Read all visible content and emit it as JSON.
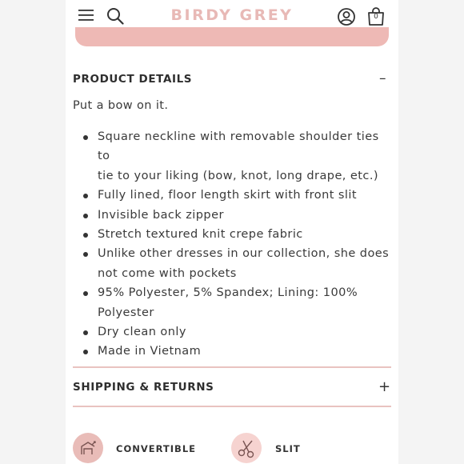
{
  "header": {
    "brand": "BIRDY GREY",
    "cart_count": "0"
  },
  "product_details": {
    "title": "PRODUCT DETAILS",
    "toggle": "–",
    "intro": "Put a bow on it.",
    "bullets": [
      [
        "Square neckline with removable shoulder ties to",
        "tie to your liking (bow, knot, long drape, etc.)"
      ],
      [
        "Fully lined, floor length skirt with front slit"
      ],
      [
        "Invisible back zipper"
      ],
      [
        "Stretch textured knit crepe fabric"
      ],
      [
        "Unlike other dresses in our collection, she does",
        "not come with pockets"
      ],
      [
        "95% Polyester, 5% Spandex; Lining: 100%",
        "Polyester"
      ],
      [
        "Dry clean only"
      ],
      [
        "Made in Vietnam"
      ]
    ]
  },
  "shipping": {
    "title": "SHIPPING & RETURNS",
    "toggle": "+"
  },
  "features": [
    {
      "label": "CONVERTIBLE",
      "icon": "convertible-icon"
    },
    {
      "label": "SLIT",
      "icon": "scissors-icon"
    }
  ],
  "colors": {
    "brand": "#e8b9b6",
    "divider": "#e9c3c0",
    "accent_bar": "#eeb9b5"
  }
}
